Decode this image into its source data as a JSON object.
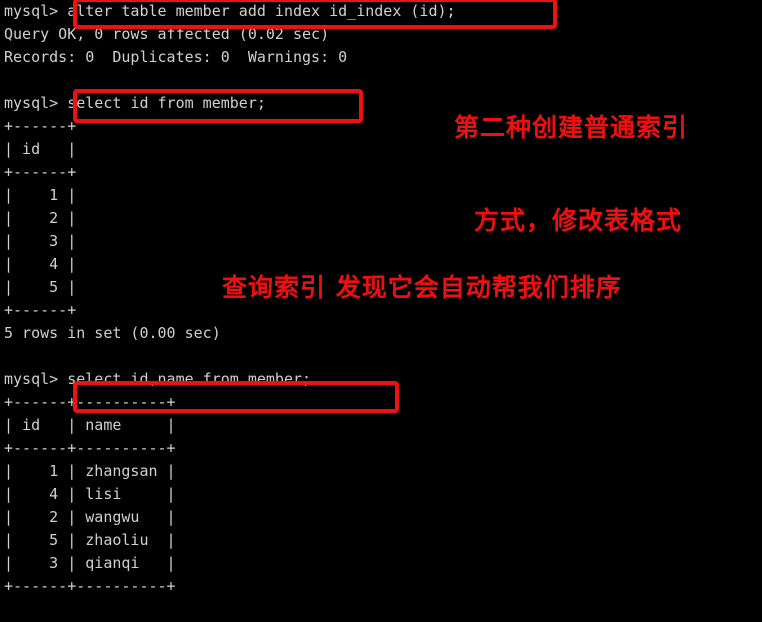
{
  "terminal": {
    "title": "mysql-client-terminal",
    "prompt": "mysql> ",
    "background_color": "#000000",
    "text_color": "#d4d0c8",
    "highlight_color": "#ee1111",
    "annotation_color": "#ee1010",
    "lines": [
      "mysql> alter table member add index id_index (id);",
      "Query OK, 0 rows affected (0.02 sec)",
      "Records: 0  Duplicates: 0  Warnings: 0",
      "",
      "mysql> select id from member;",
      "+------+",
      "| id   |",
      "+------+",
      "|    1 |",
      "|    2 |",
      "|    3 |",
      "|    4 |",
      "|    5 |",
      "+------+",
      "5 rows in set (0.00 sec)",
      "",
      "mysql> select id,name from member;",
      "+------+----------+",
      "| id   | name     |",
      "+------+----------+",
      "|    1 | zhangsan |",
      "|    4 | lisi     |",
      "|    2 | wangwu   |",
      "|    5 | zhaoliu  |",
      "|    3 | qianqi   |",
      "+------+----------+"
    ],
    "commands": [
      "alter table member add index id_index (id);",
      "select id from member;",
      "select id,name from member;"
    ],
    "results": {
      "alter_status": "Query OK, 0 rows affected (0.02 sec)",
      "alter_records": "Records: 0  Duplicates: 0  Warnings: 0",
      "select_id_rowcount": "5 rows in set (0.00 sec)",
      "id_table": {
        "columns": [
          "id"
        ],
        "rows": [
          [
            "1"
          ],
          [
            "2"
          ],
          [
            "3"
          ],
          [
            "4"
          ],
          [
            "5"
          ]
        ]
      },
      "id_name_table": {
        "columns": [
          "id",
          "name"
        ],
        "rows": [
          [
            "1",
            "zhangsan"
          ],
          [
            "4",
            "lisi"
          ],
          [
            "2",
            "wangwu"
          ],
          [
            "5",
            "zhaoliu"
          ],
          [
            "3",
            "qianqi"
          ]
        ]
      }
    },
    "annotations": [
      {
        "id": "annotation-create-index",
        "line1": "第二种创建普通索引",
        "line2": "方式，修改表格式"
      },
      {
        "id": "annotation-query-index",
        "text": "查询索引 发现它会自动帮我们排序"
      }
    ],
    "highlights": [
      {
        "id": "highlight-alter-command"
      },
      {
        "id": "highlight-select-id-command"
      },
      {
        "id": "highlight-select-id-name-command"
      }
    ]
  }
}
